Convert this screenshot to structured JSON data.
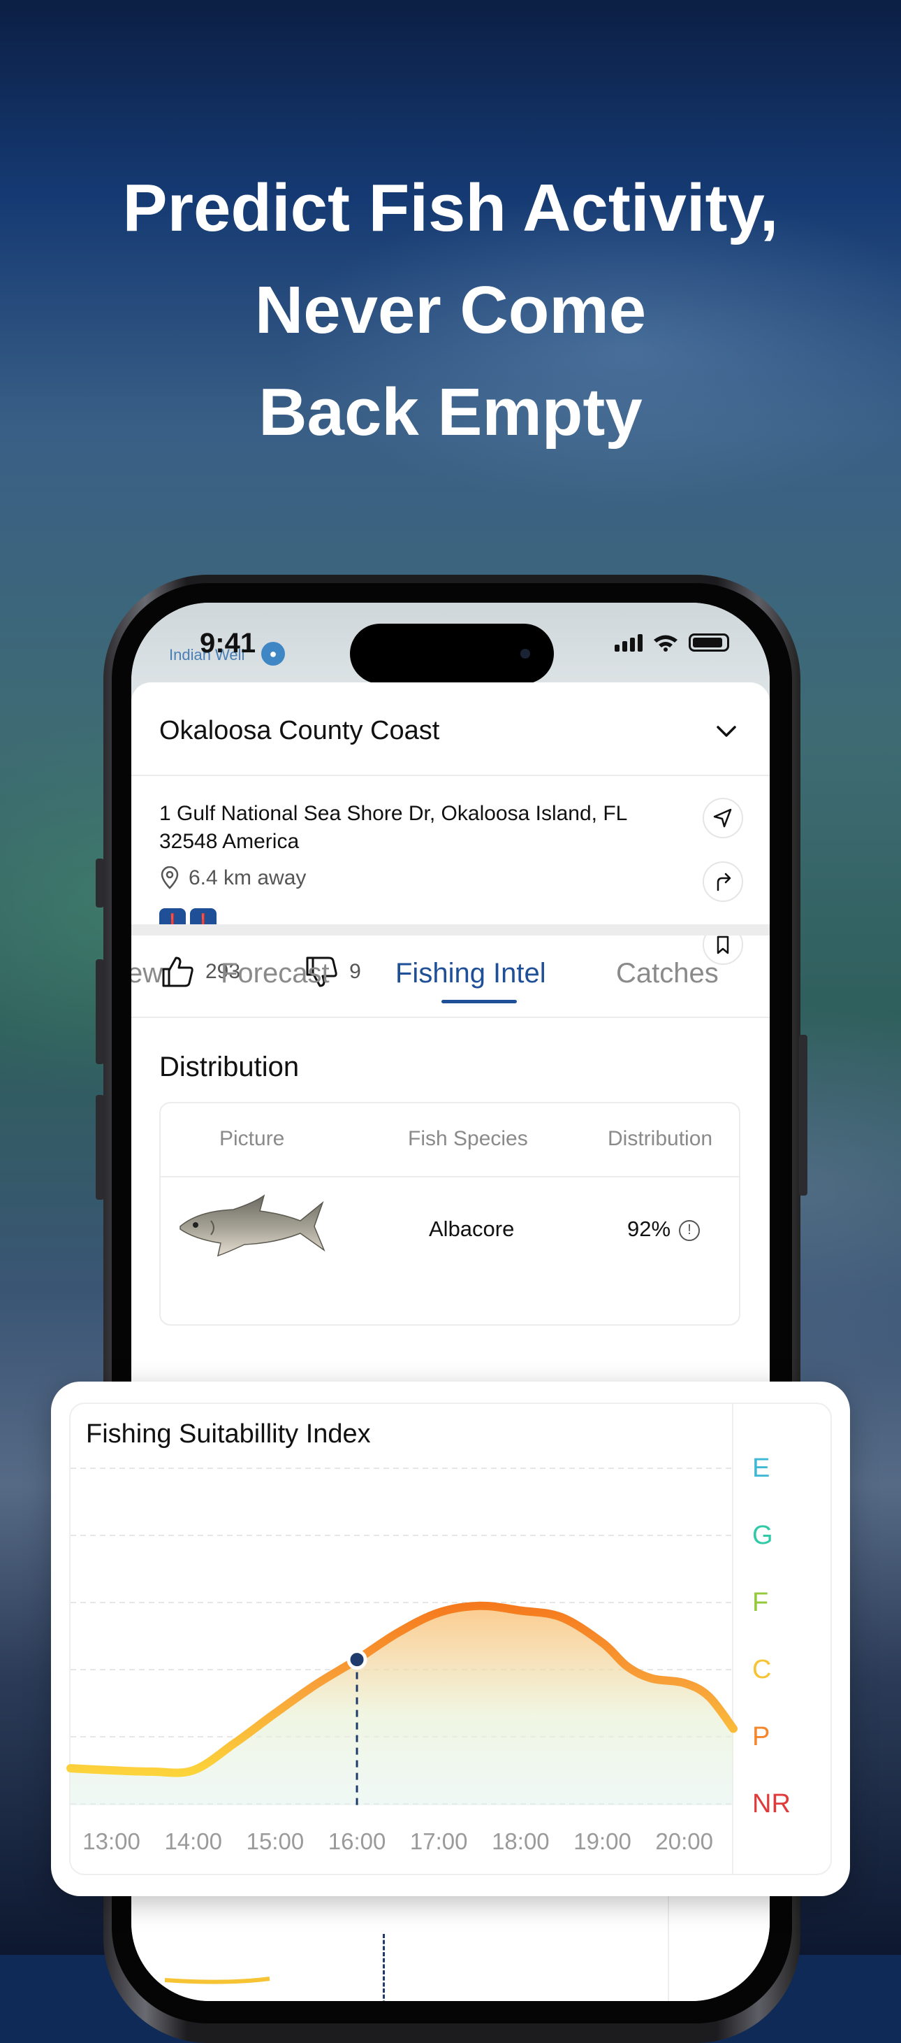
{
  "headline": {
    "line1": "Predict Fish Activity,",
    "line2": "Never Come",
    "line3": "Back Empty"
  },
  "status_bar": {
    "time": "9:41"
  },
  "map": {
    "place_label": "Indian Well"
  },
  "location": {
    "title": "Okaloosa County Coast",
    "address": "1 Gulf National Sea Shore Dr, Okaloosa Island, FL 32548 America",
    "distance": "6.4 km away",
    "likes": "293",
    "dislikes": "9"
  },
  "tabs": [
    {
      "label": "ew",
      "active": false
    },
    {
      "label": "Forecast",
      "active": false
    },
    {
      "label": "Fishing Intel",
      "active": true
    },
    {
      "label": "Catches",
      "active": false
    }
  ],
  "distribution": {
    "title": "Distribution",
    "columns": [
      "Picture",
      "Fish Species",
      "Distribution"
    ],
    "rows": [
      {
        "species": "Albacore",
        "distribution": "92%"
      }
    ]
  },
  "suitability": {
    "title": "Fishing Suitabillity Index",
    "grades": [
      {
        "label": "E",
        "color": "#3fb8d6"
      },
      {
        "label": "G",
        "color": "#2fc9a8"
      },
      {
        "label": "F",
        "color": "#94c93a"
      },
      {
        "label": "C",
        "color": "#f6c335"
      },
      {
        "label": "P",
        "color": "#f5862a"
      },
      {
        "label": "NR",
        "color": "#e03a3a"
      }
    ],
    "peek_grade": "NR"
  },
  "chart_data": {
    "type": "area",
    "title": "Fishing Suitabillity Index",
    "x": [
      "13:00",
      "14:00",
      "15:00",
      "16:00",
      "17:00",
      "18:00",
      "19:00",
      "20:00"
    ],
    "y_categories": [
      "NR",
      "P",
      "C",
      "F",
      "G",
      "E"
    ],
    "series": [
      {
        "values": [
          [
            12.5,
            0.53
          ],
          [
            13.0,
            0.5
          ],
          [
            13.5,
            0.48
          ],
          [
            14.0,
            0.5
          ],
          [
            14.5,
            0.9
          ],
          [
            15.0,
            1.35
          ],
          [
            15.5,
            1.78
          ],
          [
            16.0,
            2.15
          ],
          [
            16.5,
            2.55
          ],
          [
            17.0,
            2.85
          ],
          [
            17.5,
            2.95
          ],
          [
            18.0,
            2.88
          ],
          [
            18.5,
            2.78
          ],
          [
            19.0,
            2.4
          ],
          [
            19.3,
            2.05
          ],
          [
            19.6,
            1.87
          ],
          [
            20.0,
            1.8
          ],
          [
            20.3,
            1.6
          ],
          [
            20.6,
            1.12
          ]
        ]
      }
    ],
    "highlight_x": 16.0,
    "grid": true
  }
}
